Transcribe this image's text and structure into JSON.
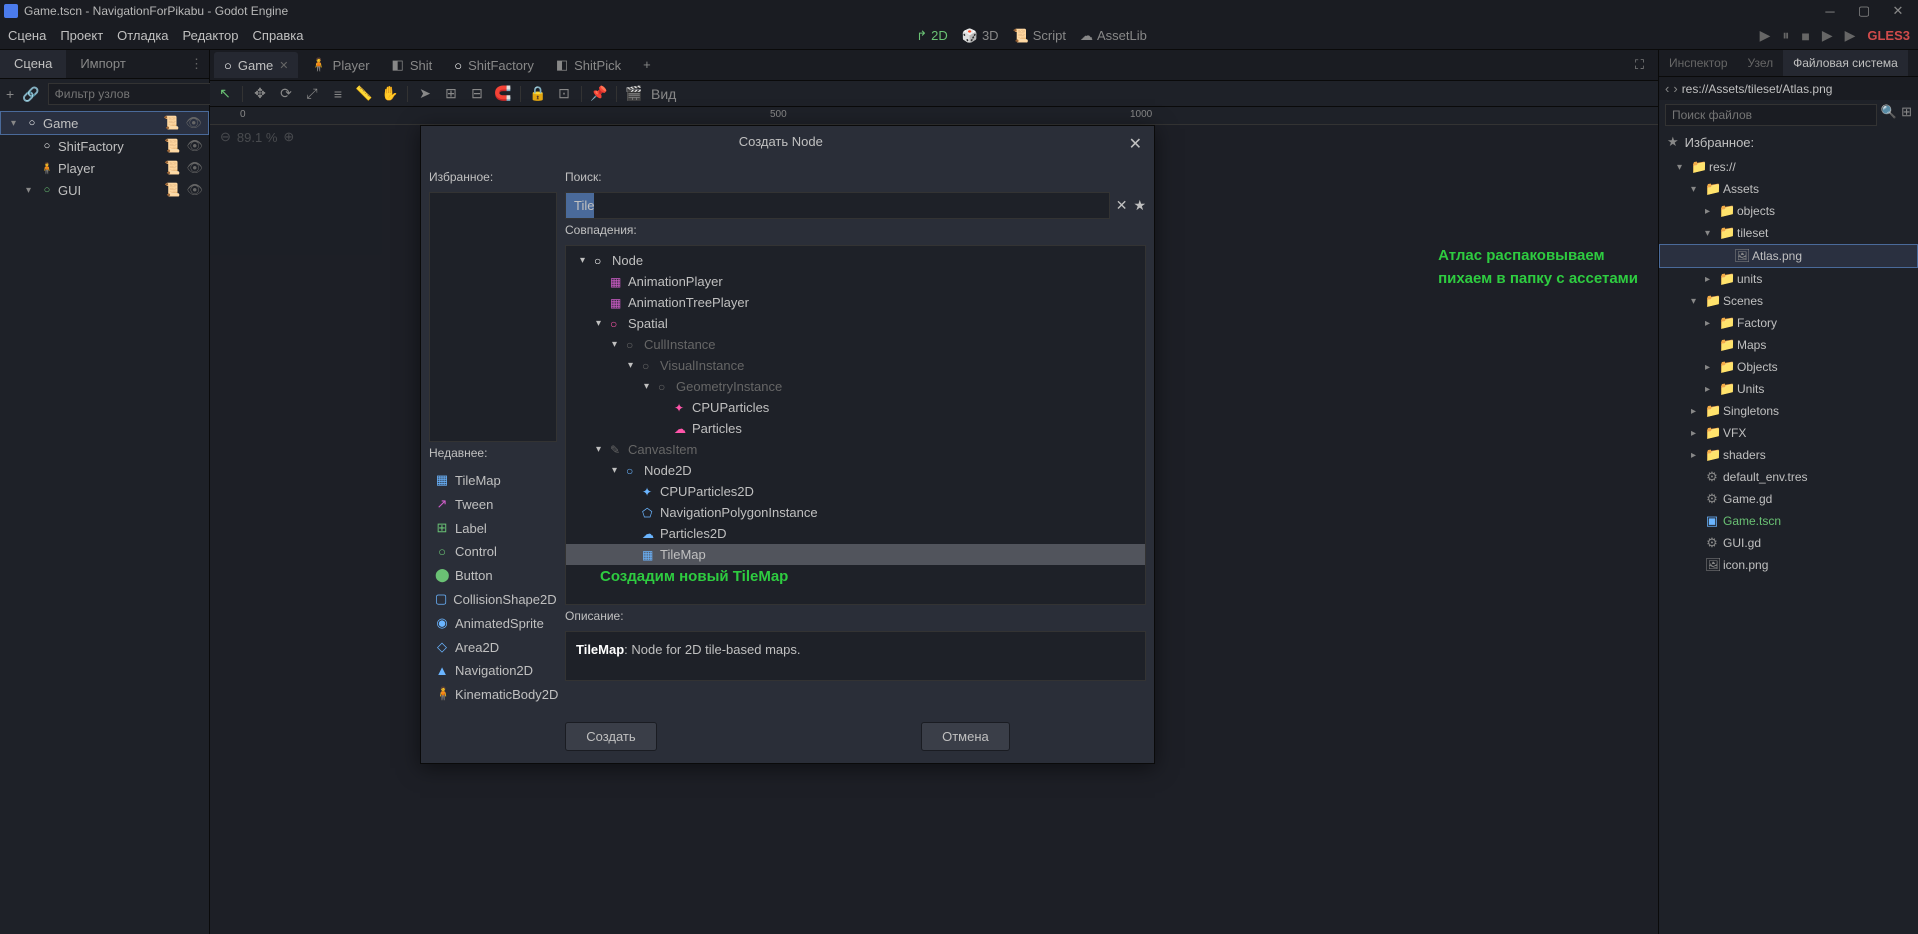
{
  "titlebar": {
    "title": "Game.tscn - NavigationForPikabu - Godot Engine"
  },
  "menubar": {
    "items": [
      "Сцена",
      "Проект",
      "Отладка",
      "Редактор",
      "Справка"
    ],
    "modes": {
      "d2": "2D",
      "d3": "3D",
      "script": "Script",
      "assetlib": "AssetLib"
    },
    "gles": "GLES3"
  },
  "left_panel": {
    "tabs": {
      "scene": "Сцена",
      "import": "Импорт"
    },
    "filter_placeholder": "Фильтр узлов",
    "tree": [
      {
        "label": "Game",
        "indent": 0,
        "expanded": true,
        "selected": true,
        "icon": "○",
        "color": "#fff"
      },
      {
        "label": "ShitFactory",
        "indent": 1,
        "icon": "○",
        "color": "#fff"
      },
      {
        "label": "Player",
        "indent": 1,
        "icon": "🧍",
        "color": "#6bb5ff"
      },
      {
        "label": "GUI",
        "indent": 1,
        "icon": "○",
        "color": "#6ac174",
        "chev": true
      }
    ]
  },
  "scene_tabs": [
    {
      "label": "Game",
      "icon": "○",
      "color": "#fff",
      "active": true
    },
    {
      "label": "Player",
      "icon": "🧍",
      "color": "#6bb5ff"
    },
    {
      "label": "Shit",
      "icon": "◧",
      "color": "#888"
    },
    {
      "label": "ShitFactory",
      "icon": "○",
      "color": "#fff"
    },
    {
      "label": "ShitPick",
      "icon": "◧",
      "color": "#888"
    }
  ],
  "viewport": {
    "zoom": "89.1 %",
    "view_label": "Вид",
    "ruler_ticks": [
      "0",
      "500",
      "1000"
    ]
  },
  "right_panel": {
    "tabs": {
      "inspector": "Инспектор",
      "node": "Узел",
      "filesystem": "Файловая система"
    },
    "path": "res://Assets/tileset/Atlas.png",
    "search_placeholder": "Поиск файлов",
    "favorites": "Избранное:",
    "tree": [
      {
        "label": "res://",
        "indent": 0,
        "type": "folder",
        "chev": "▾"
      },
      {
        "label": "Assets",
        "indent": 1,
        "type": "folder",
        "chev": "▾"
      },
      {
        "label": "objects",
        "indent": 2,
        "type": "folder",
        "chev": "▸"
      },
      {
        "label": "tileset",
        "indent": 2,
        "type": "folder",
        "chev": "▾"
      },
      {
        "label": "Atlas.png",
        "indent": 3,
        "type": "file-img",
        "selected": true
      },
      {
        "label": "units",
        "indent": 2,
        "type": "folder",
        "chev": "▸"
      },
      {
        "label": "Scenes",
        "indent": 1,
        "type": "folder",
        "chev": "▾"
      },
      {
        "label": "Factory",
        "indent": 2,
        "type": "folder",
        "chev": "▸"
      },
      {
        "label": "Maps",
        "indent": 2,
        "type": "folder"
      },
      {
        "label": "Objects",
        "indent": 2,
        "type": "folder",
        "chev": "▸"
      },
      {
        "label": "Units",
        "indent": 2,
        "type": "folder",
        "chev": "▸"
      },
      {
        "label": "Singletons",
        "indent": 1,
        "type": "folder",
        "chev": "▸"
      },
      {
        "label": "VFX",
        "indent": 1,
        "type": "folder",
        "chev": "▸"
      },
      {
        "label": "shaders",
        "indent": 1,
        "type": "folder",
        "chev": "▸"
      },
      {
        "label": "default_env.tres",
        "indent": 1,
        "type": "file-res"
      },
      {
        "label": "Game.gd",
        "indent": 1,
        "type": "file-gd"
      },
      {
        "label": "Game.tscn",
        "indent": 1,
        "type": "file-tscn",
        "highlight": true
      },
      {
        "label": "GUI.gd",
        "indent": 1,
        "type": "file-gd"
      },
      {
        "label": "icon.png",
        "indent": 1,
        "type": "file-img"
      }
    ]
  },
  "dialog": {
    "title": "Создать Node",
    "favorites_label": "Избранное:",
    "recent_label": "Недавнее:",
    "search_label": "Поиск:",
    "search_value": "Tile",
    "matches_label": "Совпадения:",
    "description_label": "Описание:",
    "description_name": "TileMap",
    "description_text": ": Node for 2D tile-based maps.",
    "create_btn": "Создать",
    "cancel_btn": "Отмена",
    "recent": [
      {
        "label": "TileMap",
        "icon": "▦",
        "color": "#6bb5ff"
      },
      {
        "label": "Tween",
        "icon": "↗",
        "color": "#d05eca"
      },
      {
        "label": "Label",
        "icon": "⊞",
        "color": "#6ac174"
      },
      {
        "label": "Control",
        "icon": "○",
        "color": "#6ac174"
      },
      {
        "label": "Button",
        "icon": "⬤",
        "color": "#6ac174"
      },
      {
        "label": "CollisionShape2D",
        "icon": "▢",
        "color": "#6bb5ff"
      },
      {
        "label": "AnimatedSprite",
        "icon": "◉",
        "color": "#6bb5ff"
      },
      {
        "label": "Area2D",
        "icon": "◇",
        "color": "#6bb5ff"
      },
      {
        "label": "Navigation2D",
        "icon": "▲",
        "color": "#6bb5ff"
      },
      {
        "label": "KinematicBody2D",
        "icon": "🧍",
        "color": "#6bb5ff"
      }
    ],
    "matches": [
      {
        "label": "Node",
        "indent": 0,
        "chev": "▾",
        "icon": "○",
        "color": "#fff"
      },
      {
        "label": "AnimationPlayer",
        "indent": 1,
        "icon": "▦",
        "color": "#d05eca"
      },
      {
        "label": "AnimationTreePlayer",
        "indent": 1,
        "icon": "▦",
        "color": "#d05eca"
      },
      {
        "label": "Spatial",
        "indent": 1,
        "chev": "▾",
        "icon": "○",
        "color": "#f5a"
      },
      {
        "label": "CullInstance",
        "indent": 2,
        "chev": "▾",
        "icon": "○",
        "dim": true
      },
      {
        "label": "VisualInstance",
        "indent": 3,
        "chev": "▾",
        "icon": "○",
        "dim": true
      },
      {
        "label": "GeometryInstance",
        "indent": 4,
        "chev": "▾",
        "icon": "○",
        "dim": true
      },
      {
        "label": "CPUParticles",
        "indent": 5,
        "icon": "✦",
        "color": "#f5a"
      },
      {
        "label": "Particles",
        "indent": 5,
        "icon": "☁",
        "color": "#f5a"
      },
      {
        "label": "CanvasItem",
        "indent": 1,
        "chev": "▾",
        "icon": "✎",
        "dim": true
      },
      {
        "label": "Node2D",
        "indent": 2,
        "chev": "▾",
        "icon": "○",
        "color": "#6bb5ff"
      },
      {
        "label": "CPUParticles2D",
        "indent": 3,
        "icon": "✦",
        "color": "#6bb5ff"
      },
      {
        "label": "NavigationPolygonInstance",
        "indent": 3,
        "icon": "⬠",
        "color": "#6bb5ff"
      },
      {
        "label": "Particles2D",
        "indent": 3,
        "icon": "☁",
        "color": "#6bb5ff"
      },
      {
        "label": "TileMap",
        "indent": 3,
        "icon": "▦",
        "color": "#6bb5ff",
        "selected": true
      }
    ]
  },
  "annotations": {
    "a1": "Атлас распаковываем\nпихаем в папку с ассетами",
    "a2": "Создадим новый TileMap"
  }
}
